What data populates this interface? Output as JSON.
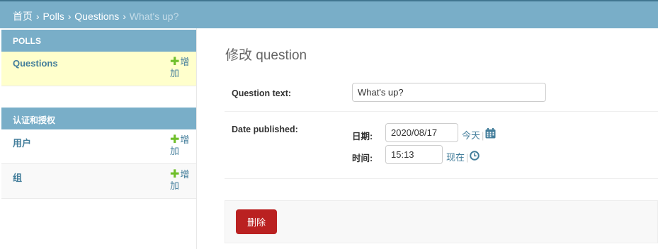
{
  "breadcrumbs": {
    "home": "首页",
    "sep": "›",
    "app": "Polls",
    "model": "Questions",
    "current": "What's up?"
  },
  "sidebar": {
    "modules": [
      {
        "caption": "POLLS",
        "models": [
          {
            "name": "Questions",
            "add_label": "增加",
            "selected": true
          }
        ]
      },
      {
        "caption": "认证和授权",
        "models": [
          {
            "name": "用户",
            "add_label": "增加"
          },
          {
            "name": "组",
            "add_label": "增加"
          }
        ]
      }
    ]
  },
  "main": {
    "title": "修改 question",
    "question_text": {
      "label": "Question text:",
      "value": "What's up?"
    },
    "date_published": {
      "label": "Date published:",
      "date_label": "日期:",
      "date_value": "2020/08/17",
      "today_label": "今天",
      "time_label": "时间:",
      "time_value": "15:13",
      "now_label": "现在",
      "pipe": "|"
    },
    "delete_label": "删除"
  },
  "colors": {
    "header_bg": "#79aec8",
    "link": "#447e9b",
    "add_icon": "#70bf2b",
    "selected_row": "#ffffcc",
    "delete_button": "#ba2121"
  },
  "icons": {
    "add": "plus-icon",
    "calendar": "calendar-icon",
    "clock": "clock-icon"
  }
}
